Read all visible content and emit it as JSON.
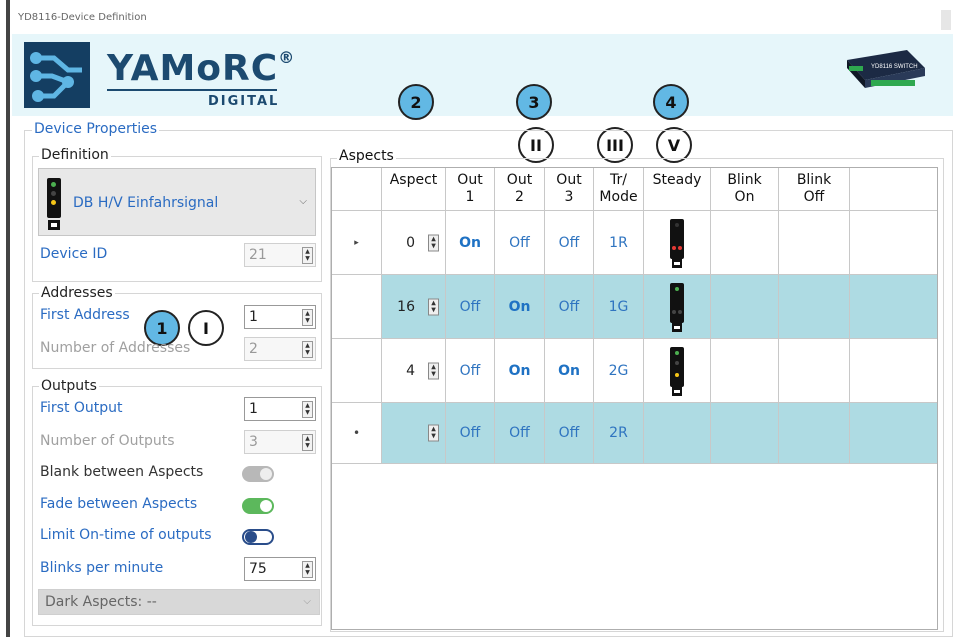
{
  "window": {
    "title": "YD8116-Device Definition"
  },
  "logo": {
    "brand": "YAMoRC",
    "reg": "®",
    "sub": "DIGITAL"
  },
  "callouts": {
    "c1": "1",
    "cI": "I",
    "c2": "2",
    "c3": "3",
    "cII": "II",
    "cIII": "III",
    "c4": "4",
    "cV": "V"
  },
  "device_properties": {
    "title": "Device Properties",
    "definition": {
      "title": "Definition",
      "selected": "DB H/V Einfahrsignal",
      "device_id_label": "Device ID",
      "device_id": "21"
    },
    "addresses": {
      "title": "Addresses",
      "first_address_label": "First Address",
      "first_address": "1",
      "number_label": "Number of Addresses",
      "number": "2"
    },
    "outputs": {
      "title": "Outputs",
      "first_output_label": "First Output",
      "first_output": "1",
      "number_label": "Number of Outputs",
      "number": "3",
      "blank_label": "Blank between Aspects",
      "fade_label": "Fade between Aspects",
      "limit_label": "Limit On-time of outputs",
      "blinks_label": "Blinks per minute",
      "blinks": "75",
      "dark_aspects": "Dark Aspects: --"
    }
  },
  "aspects": {
    "title": "Aspects",
    "headers": {
      "aspect": "Aspect",
      "out1": "Out\n1",
      "out2": "Out\n2",
      "out3": "Out\n3",
      "tr": "Tr/\nMode",
      "steady": "Steady",
      "blink_on": "Blink\nOn",
      "blink_off": "Blink\nOff"
    },
    "rows": [
      {
        "selector": "▸",
        "aspect": "0",
        "out1": "On",
        "out2": "Off",
        "out3": "Off",
        "tr": "1R"
      },
      {
        "selector": "",
        "aspect": "16",
        "out1": "Off",
        "out2": "On",
        "out3": "Off",
        "tr": "1G"
      },
      {
        "selector": "",
        "aspect": "4",
        "out1": "Off",
        "out2": "On",
        "out3": "On",
        "tr": "2G"
      },
      {
        "selector": "•",
        "aspect": "",
        "out1": "Off",
        "out2": "Off",
        "out3": "Off",
        "tr": "2R"
      }
    ]
  },
  "colors": {
    "accent_blue": "#2a6bc2",
    "callout_fill": "#62b8e4",
    "row_highlight": "#aedbe3",
    "toggle_on": "#5cb85c",
    "signal_red": "#e53935",
    "signal_green": "#4caf50"
  },
  "toggles": {
    "blank": "disabled",
    "fade": "on",
    "limit": "off"
  }
}
